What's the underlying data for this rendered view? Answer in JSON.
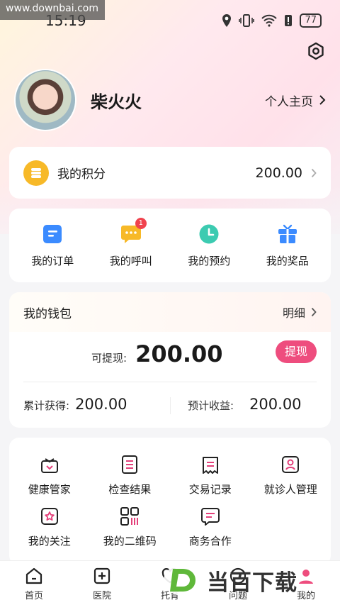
{
  "watermark": "www.downbai.com",
  "status_bar": {
    "time": "15:19",
    "battery": "77"
  },
  "profile": {
    "nickname": "柴火火",
    "homepage_label": "个人主页"
  },
  "points": {
    "label": "我的积分",
    "value": "200.00"
  },
  "shortcuts": [
    {
      "label": "我的订单",
      "icon": "order-icon",
      "color": "#3b8bff"
    },
    {
      "label": "我的呼叫",
      "icon": "chat-bubble-icon",
      "color": "#f7b928",
      "badge": "1"
    },
    {
      "label": "我的预约",
      "icon": "clock-icon",
      "color": "#3ccbb1"
    },
    {
      "label": "我的奖品",
      "icon": "gift-icon",
      "color": "#3b8bff"
    }
  ],
  "wallet": {
    "title": "我的钱包",
    "detail_label": "明细",
    "withdrawable_label": "可提现:",
    "withdrawable_value": "200.00",
    "withdraw_button": "提现",
    "accumulated_label": "累计获得:",
    "accumulated_value": "200.00",
    "expected_label": "预计收益:",
    "expected_value": "200.00"
  },
  "services": [
    {
      "label": "健康管家",
      "icon": "health-basket-icon"
    },
    {
      "label": "检查结果",
      "icon": "report-icon"
    },
    {
      "label": "交易记录",
      "icon": "transaction-icon"
    },
    {
      "label": "就诊人管理",
      "icon": "patient-icon"
    },
    {
      "label": "我的关注",
      "icon": "favorite-icon"
    },
    {
      "label": "我的二维码",
      "icon": "qrcode-icon"
    },
    {
      "label": "商务合作",
      "icon": "cooperation-icon"
    }
  ],
  "colors": {
    "accent": "#ee4d7e",
    "coin": "#f7b928"
  },
  "tabbar": [
    {
      "label": "首页",
      "icon": "home-icon"
    },
    {
      "label": "医院",
      "icon": "hospital-icon"
    },
    {
      "label": "托育",
      "icon": "care-icon"
    },
    {
      "label": "问题",
      "icon": "question-icon"
    },
    {
      "label": "我的",
      "icon": "user-icon"
    }
  ],
  "logo_watermark": "当百下载"
}
